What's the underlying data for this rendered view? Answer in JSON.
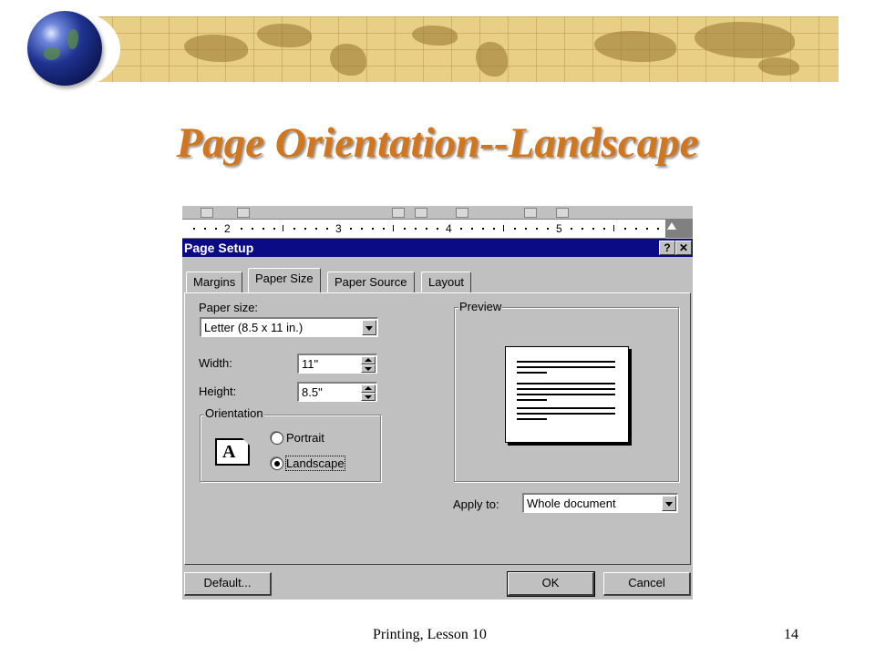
{
  "slide": {
    "title": "Page Orientation--Landscape",
    "footer_left": "Printing, Lesson 10",
    "page_number": "14"
  },
  "ruler": {
    "numbers": [
      "2",
      "3",
      "4",
      "5"
    ]
  },
  "dialog": {
    "title": "Page Setup",
    "help_glyph": "?",
    "close_glyph": "✕",
    "tabs": [
      {
        "label": "Margins",
        "active": false
      },
      {
        "label": "Paper Size",
        "active": true
      },
      {
        "label": "Paper Source",
        "active": false
      },
      {
        "label": "Layout",
        "active": false
      }
    ],
    "paper_size_label": "Paper size:",
    "paper_size_value": "Letter (8.5 x 11 in.)",
    "width_label": "Width:",
    "width_value": "11\"",
    "height_label": "Height:",
    "height_value": "8.5\"",
    "orientation_label": "Orientation",
    "orientation_icon_letter": "A",
    "portrait_label": "Portrait",
    "landscape_label": "Landscape",
    "selected_orientation": "Landscape",
    "preview_label": "Preview",
    "apply_to_label": "Apply to:",
    "apply_to_value": "Whole document",
    "default_button": "Default...",
    "ok_button": "OK",
    "cancel_button": "Cancel"
  },
  "colors": {
    "title": "#d2761e",
    "dialog_titlebar": "#0c0b86",
    "dialog_face": "#c0c0c0",
    "banner": "#e9cf86"
  },
  "icons": [
    "globe-icon",
    "help-icon",
    "close-icon",
    "dropdown-arrow-icon",
    "spinner-icon",
    "orientation-page-icon"
  ]
}
